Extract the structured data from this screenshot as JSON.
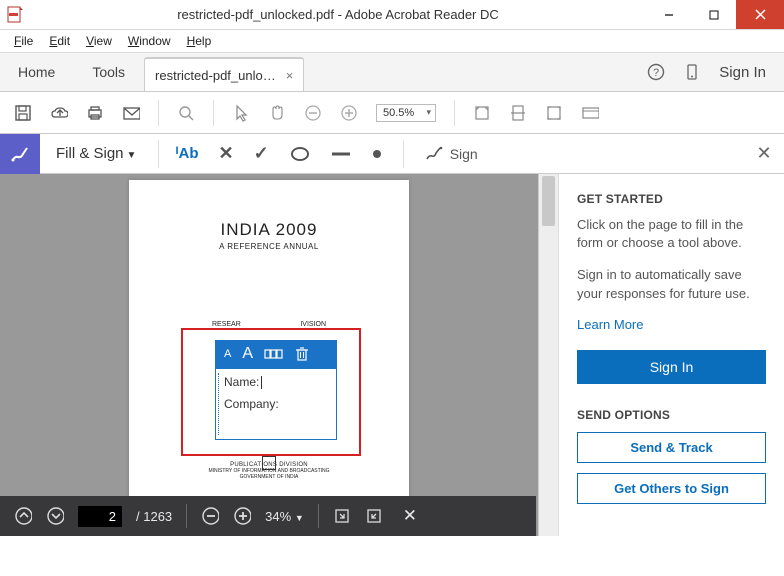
{
  "window": {
    "title": "restricted-pdf_unlocked.pdf - Adobe Acrobat Reader DC"
  },
  "menu": {
    "file": "File",
    "edit": "Edit",
    "view": "View",
    "window": "Window",
    "help": "Help"
  },
  "tabs": {
    "home": "Home",
    "tools": "Tools",
    "doc": "restricted-pdf_unlo…",
    "signin": "Sign In"
  },
  "toolbar": {
    "zoom": "50.5%"
  },
  "fillsign": {
    "label": "Fill & Sign",
    "ab": "Ab",
    "sign": "Sign"
  },
  "page": {
    "title": "INDIA  2009",
    "subtitle": "A REFERENCE ANNUAL",
    "line3_left": "RESEAR",
    "line3_right": "IVISION",
    "pub1": "PUBLICATIONS  DIVISION",
    "pub2": "MINISTRY OF INFORMATION AND BROADCASTING",
    "pub3": "GOVERNMENT OF INDIA"
  },
  "textbox": {
    "name": "Name:",
    "company": "Company:"
  },
  "pagenav": {
    "current": "2",
    "total": "1263",
    "zoom": "34%"
  },
  "sidebar": {
    "h1": "GET STARTED",
    "p1": "Click on the page to fill in the form or choose a tool above.",
    "p2": "Sign in to automatically save your responses for future use.",
    "learn": "Learn More",
    "signin": "Sign In",
    "h2": "SEND OPTIONS",
    "send": "Send & Track",
    "others": "Get Others to Sign"
  }
}
